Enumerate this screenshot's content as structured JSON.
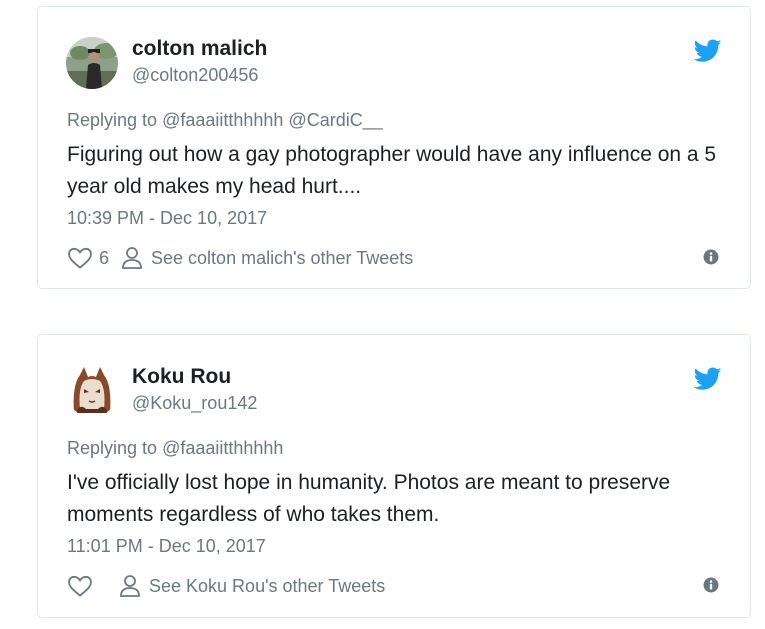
{
  "colors": {
    "text": "#1c2022",
    "muted": "#697882",
    "twitter_blue": "#1da1f2",
    "border": "#e1e8ed"
  },
  "tweets": [
    {
      "name": "colton malich",
      "handle": "@colton200456",
      "replying_prefix": "Replying to",
      "replying_to": "@faaaiitthhhhh @CardiC__",
      "text": "Figuring out how a gay photographer would have any influence on a 5 year old makes my head hurt....",
      "timestamp": "10:39 PM - Dec 10, 2017",
      "likes": "6",
      "other_tweets_label": "See colton malich's other Tweets",
      "icons": {
        "like": "heart-icon",
        "profile": "person-icon",
        "info": "info-icon",
        "logo": "twitter-bird-icon"
      }
    },
    {
      "name": "Koku Rou",
      "handle": "@Koku_rou142",
      "replying_prefix": "Replying to",
      "replying_to": "@faaaiitthhhhh",
      "text": "I've officially lost hope in humanity. Photos are meant to preserve moments regardless of who takes them.",
      "timestamp": "11:01 PM - Dec 10, 2017",
      "likes": "",
      "other_tweets_label": "See Koku Rou's other Tweets",
      "icons": {
        "like": "heart-icon",
        "profile": "person-icon",
        "info": "info-icon",
        "logo": "twitter-bird-icon"
      }
    }
  ]
}
